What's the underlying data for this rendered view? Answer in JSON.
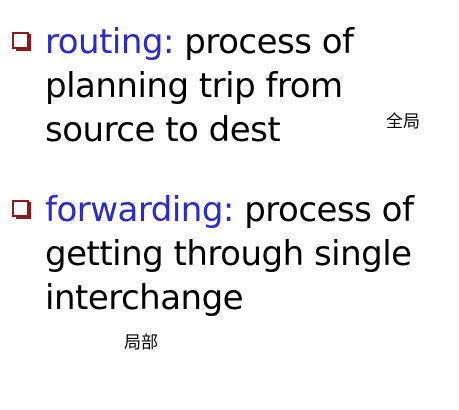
{
  "bullets": [
    {
      "term": "routing:",
      "description": "process of planning trip from source to dest"
    },
    {
      "term": "forwarding:",
      "description": "process of getting through single interchange"
    }
  ],
  "annotations": {
    "global": "全局",
    "local": "局部"
  },
  "colors": {
    "term": "#2a2ad0",
    "body_text": "#000000",
    "bullet_marker": "#8b1a1a",
    "background": "#ffffff"
  },
  "icons": {
    "bullet_marker": "checkbox-bullet-icon"
  }
}
